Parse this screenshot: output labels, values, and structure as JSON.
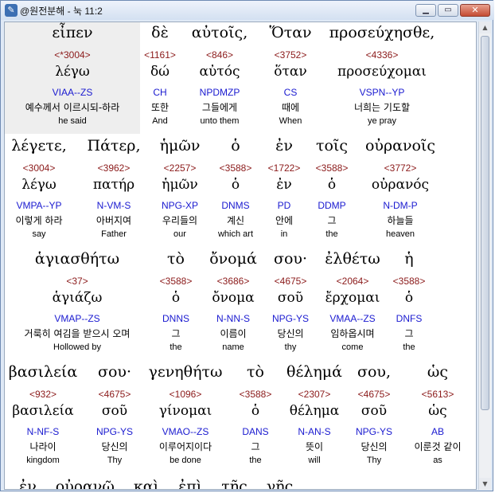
{
  "window": {
    "title": "@원전분해 - 눅 11:2",
    "icon": "app-icon",
    "buttons": {
      "minimize": "minimize-icon",
      "maximize": "maximize-icon",
      "close": "close-icon"
    }
  },
  "colors": {
    "strong": "#8b1a1a",
    "parsing": "#1a1ad0",
    "selected_bg": "#eeeeee"
  },
  "rows": [
    {
      "words": [
        {
          "greek": "εἶπεν",
          "strong": "<*3004>",
          "lemma": "λέγω",
          "parse": "VIAA--ZS",
          "korean": "예수께서 이르시되-하라",
          "english": "he said",
          "selected": true
        },
        {
          "greek": "δὲ",
          "strong": "<1161>",
          "lemma": "δώ",
          "parse": "CH",
          "korean": "또한",
          "english": "And"
        },
        {
          "greek": "αὐτοῖς,",
          "strong": "<846>",
          "lemma": "αὐτός",
          "parse": "NPDMZP",
          "korean": "그들에게",
          "english": "unto them"
        },
        {
          "greek": "Ὅταν",
          "strong": "<3752>",
          "lemma": "ὅταν",
          "parse": "CS",
          "korean": "때에",
          "english": "When"
        },
        {
          "greek": "προσεύχησθε,",
          "strong": "<4336>",
          "lemma": "προσεύχομαι",
          "parse": "VSPN--YP",
          "korean": "너희는 기도할",
          "english": "ye pray"
        }
      ]
    },
    {
      "words": [
        {
          "greek": "λέγετε,",
          "strong": "<3004>",
          "lemma": "λέγω",
          "parse": "VMPA--YP",
          "korean": "이렇게 하라",
          "english": "say"
        },
        {
          "greek": "Πάτερ,",
          "strong": "<3962>",
          "lemma": "πατήρ",
          "parse": "N-VM-S",
          "korean": "아버지여",
          "english": "Father"
        },
        {
          "greek": "ἡμῶν",
          "strong": "<2257>",
          "lemma": "ἡμῶν",
          "parse": "NPG-XP",
          "korean": "우리들의",
          "english": "our"
        },
        {
          "greek": "ὁ",
          "strong": "<3588>",
          "lemma": "ὁ",
          "parse": "DNMS",
          "korean": "계신",
          "english": "which art"
        },
        {
          "greek": "ἐν",
          "strong": "<1722>",
          "lemma": "ἐν",
          "parse": "PD",
          "korean": "안에",
          "english": "in"
        },
        {
          "greek": "τοῖς",
          "strong": "<3588>",
          "lemma": "ὁ",
          "parse": "DDMP",
          "korean": "그",
          "english": "the"
        },
        {
          "greek": "οὐρανοῖς",
          "strong": "<3772>",
          "lemma": "οὐρανός",
          "parse": "N-DM-P",
          "korean": "하늘들",
          "english": "heaven"
        }
      ]
    },
    {
      "words": [
        {
          "greek": "ἁγιασθήτω",
          "strong": "<37>",
          "lemma": "ἁγιάζω",
          "parse": "VMAP--ZS",
          "korean": "거룩히 여김을 받으시 오며",
          "english": "Hollowed by"
        },
        {
          "greek": "τὸ",
          "strong": "<3588>",
          "lemma": "ὁ",
          "parse": "DNNS",
          "korean": "그",
          "english": "the"
        },
        {
          "greek": "ὄνομά",
          "strong": "<3686>",
          "lemma": "ὄνομα",
          "parse": "N-NN-S",
          "korean": "이름이",
          "english": "name"
        },
        {
          "greek": "σου·",
          "strong": "<4675>",
          "lemma": "σοῦ",
          "parse": "NPG-YS",
          "korean": "당신의",
          "english": "thy"
        },
        {
          "greek": "ἐλθέτω",
          "strong": "<2064>",
          "lemma": "ἔρχομαι",
          "parse": "VMAA--ZS",
          "korean": "임하옵시며",
          "english": "come"
        },
        {
          "greek": "ἡ",
          "strong": "<3588>",
          "lemma": "ὁ",
          "parse": "DNFS",
          "korean": "그",
          "english": "the"
        }
      ]
    },
    {
      "words": [
        {
          "greek": "βασιλεία",
          "strong": "<932>",
          "lemma": "βασιλεία",
          "parse": "N-NF-S",
          "korean": "나라이",
          "english": "kingdom"
        },
        {
          "greek": "σου·",
          "strong": "<4675>",
          "lemma": "σοῦ",
          "parse": "NPG-YS",
          "korean": "당신의",
          "english": "Thy"
        },
        {
          "greek": "γενηθήτω",
          "strong": "<1096>",
          "lemma": "γίνομαι",
          "parse": "VMAO--ZS",
          "korean": "이루어지이다",
          "english": "be done"
        },
        {
          "greek": "τὸ",
          "strong": "<3588>",
          "lemma": "ὁ",
          "parse": "DANS",
          "korean": "그",
          "english": "the"
        },
        {
          "greek": "θέλημά",
          "strong": "<2307>",
          "lemma": "θέλημα",
          "parse": "N-AN-S",
          "korean": "뜻이",
          "english": "will"
        },
        {
          "greek": "σου,",
          "strong": "<4675>",
          "lemma": "σοῦ",
          "parse": "NPG-YS",
          "korean": "당신의",
          "english": "Thy"
        },
        {
          "greek": "ὡς",
          "strong": "<5613>",
          "lemma": "ὡς",
          "parse": "AB",
          "korean": "이룬것 같이",
          "english": "as"
        }
      ]
    }
  ],
  "next_row_peek": [
    "ἐν",
    "οὐρανῷ",
    "καὶ",
    "ἐπὶ",
    "τῆς",
    "γῆς"
  ]
}
